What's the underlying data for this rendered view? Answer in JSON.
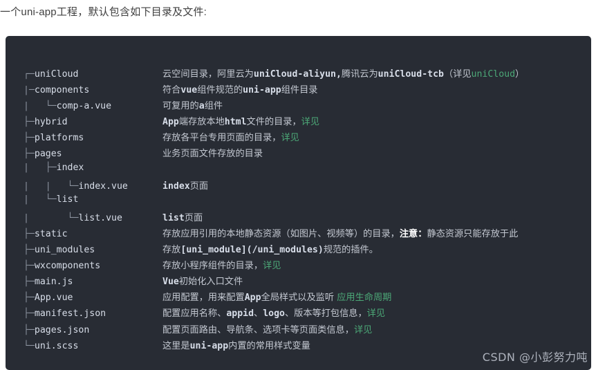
{
  "intro": {
    "text": "一个uni-app工程，默认包含如下目录及文件:"
  },
  "colors": {
    "code_background": "#282c34",
    "tree_branch": "#8b929e",
    "file_name": "#d8dee9",
    "description": "#c3c8d1",
    "link": "#4ca877",
    "warning": "#ffffff",
    "page_background": "#ffffff",
    "intro_text": "#3f3f3f"
  },
  "tree": {
    "rows": [
      {
        "tree": "┌─uniCloud",
        "branch": "┌─",
        "name": "uniCloud",
        "desc_parts": [
          {
            "t": "云空间目录，阿里云为",
            "k": "zh"
          },
          {
            "t": "uniCloud-aliyun,",
            "k": "mono"
          },
          {
            "t": "腾讯云为",
            "k": "zh"
          },
          {
            "t": "uniCloud-tcb",
            "k": "mono"
          },
          {
            "t": "（详见",
            "k": "zh"
          },
          {
            "t": "uniCloud",
            "k": "link"
          },
          {
            "t": "）",
            "k": "zh"
          }
        ]
      },
      {
        "tree": "|─components",
        "branch": "|─",
        "name": "components",
        "desc_parts": [
          {
            "t": "符合",
            "k": "zh"
          },
          {
            "t": "vue",
            "k": "mono"
          },
          {
            "t": "组件规范的",
            "k": "zh"
          },
          {
            "t": "uni-app",
            "k": "mono"
          },
          {
            "t": "组件目录",
            "k": "zh"
          }
        ]
      },
      {
        "tree": "|   └─comp-a.vue",
        "branch": "|   └─",
        "name": "comp-a.vue",
        "desc_parts": [
          {
            "t": "可复用的",
            "k": "zh"
          },
          {
            "t": "a",
            "k": "mono"
          },
          {
            "t": "组件",
            "k": "zh"
          }
        ]
      },
      {
        "tree": "├─hybrid",
        "branch": "├─",
        "name": "hybrid",
        "desc_parts": [
          {
            "t": "App",
            "k": "mono"
          },
          {
            "t": "端存放本地",
            "k": "zh"
          },
          {
            "t": "html",
            "k": "mono"
          },
          {
            "t": "文件的目录，",
            "k": "zh"
          },
          {
            "t": "详见",
            "k": "link"
          }
        ]
      },
      {
        "tree": "├─platforms",
        "branch": "├─",
        "name": "platforms",
        "desc_parts": [
          {
            "t": "存放各平台专用页面的目录，",
            "k": "zh"
          },
          {
            "t": "详见",
            "k": "link"
          }
        ]
      },
      {
        "tree": "├─pages",
        "branch": "├─",
        "name": "pages",
        "desc_parts": [
          {
            "t": "业务页面文件存放的目录",
            "k": "zh"
          }
        ]
      },
      {
        "tree": "|   ├─index",
        "branch": "|   ├─",
        "name": "index",
        "desc_parts": []
      },
      {
        "tree": "|   |   └─index.vue",
        "branch": "|   |   └─",
        "name": "index.vue",
        "desc_parts": [
          {
            "t": "index",
            "k": "mono"
          },
          {
            "t": "页面",
            "k": "zh"
          }
        ]
      },
      {
        "tree": "|   └─list",
        "branch": "|   └─",
        "name": "list",
        "desc_parts": []
      },
      {
        "tree": "|       └─list.vue",
        "branch": "|       └─",
        "name": "list.vue",
        "desc_parts": [
          {
            "t": "list",
            "k": "mono"
          },
          {
            "t": "页面",
            "k": "zh"
          }
        ]
      },
      {
        "tree": "├─static",
        "branch": "├─",
        "name": "static",
        "desc_parts": [
          {
            "t": "存放应用引用的本地静态资源（如图片、视频等）的目录，",
            "k": "zh"
          },
          {
            "t": "注意：",
            "k": "warn"
          },
          {
            "t": "静态资源只能存放于此",
            "k": "zh"
          }
        ]
      },
      {
        "tree": "├─uni_modules",
        "branch": "├─",
        "name": "uni_modules",
        "desc_parts": [
          {
            "t": "存放",
            "k": "zh"
          },
          {
            "t": "[uni_module](/uni_modules)",
            "k": "mono"
          },
          {
            "t": "规范的插件。",
            "k": "zh"
          }
        ]
      },
      {
        "tree": "├─wxcomponents",
        "branch": "├─",
        "name": "wxcomponents",
        "desc_parts": [
          {
            "t": "存放小程序组件的目录，",
            "k": "zh"
          },
          {
            "t": "详见",
            "k": "link"
          }
        ]
      },
      {
        "tree": "├─main.js",
        "branch": "├─",
        "name": "main.js",
        "desc_parts": [
          {
            "t": "Vue",
            "k": "mono"
          },
          {
            "t": "初始化入口文件",
            "k": "zh"
          }
        ]
      },
      {
        "tree": "├─App.vue",
        "branch": "├─",
        "name": "App.vue",
        "desc_parts": [
          {
            "t": "应用配置，用来配置",
            "k": "zh"
          },
          {
            "t": "App",
            "k": "mono"
          },
          {
            "t": "全局样式以及监听 ",
            "k": "zh"
          },
          {
            "t": "应用生命周期",
            "k": "link"
          }
        ]
      },
      {
        "tree": "├─manifest.json",
        "branch": "├─",
        "name": "manifest.json",
        "desc_parts": [
          {
            "t": "配置应用名称、",
            "k": "zh"
          },
          {
            "t": "appid",
            "k": "mono"
          },
          {
            "t": "、",
            "k": "zh"
          },
          {
            "t": "logo",
            "k": "mono"
          },
          {
            "t": "、版本等打包信息，",
            "k": "zh"
          },
          {
            "t": "详见",
            "k": "link"
          }
        ]
      },
      {
        "tree": "├─pages.json",
        "branch": "├─",
        "name": "pages.json",
        "desc_parts": [
          {
            "t": "配置页面路由、导航条、选项卡等页面类信息，",
            "k": "zh"
          },
          {
            "t": "详见",
            "k": "link"
          }
        ]
      },
      {
        "tree": "└─uni.scss",
        "branch": "└─",
        "name": "uni.scss",
        "desc_parts": [
          {
            "t": "这里是",
            "k": "zh"
          },
          {
            "t": "uni-app",
            "k": "mono"
          },
          {
            "t": "内置的常用样式变量",
            "k": "zh"
          }
        ]
      }
    ]
  },
  "watermark": {
    "text": "CSDN @小彭努力吨"
  }
}
